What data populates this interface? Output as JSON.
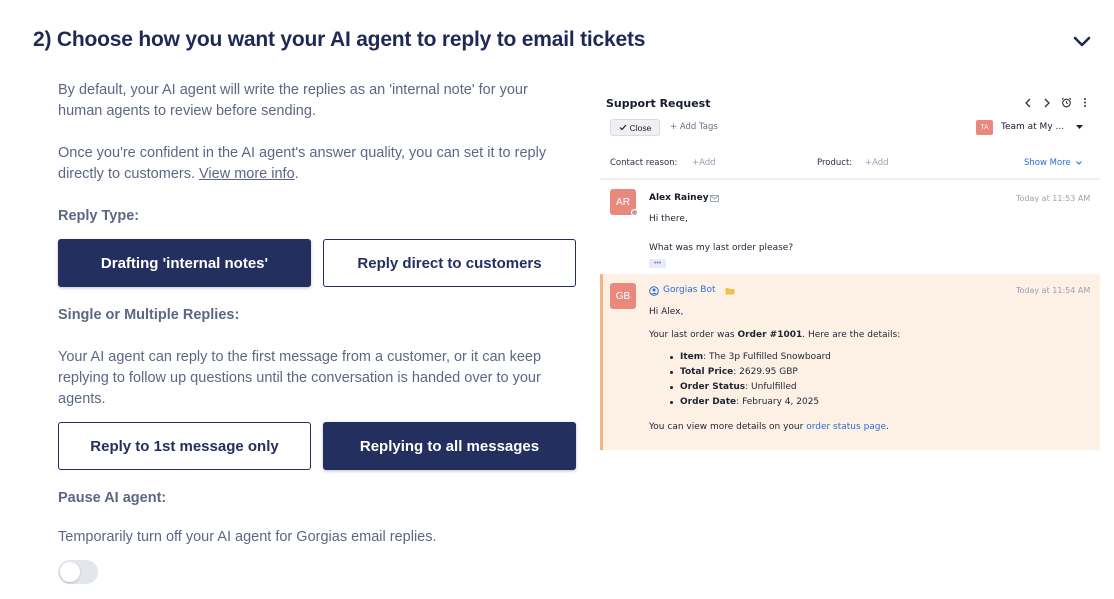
{
  "section": {
    "title": "2) Choose how you want your AI agent to reply to email tickets",
    "collapse_icon": "chevron-down-icon"
  },
  "intro": {
    "p1": "By default, your AI agent will write the replies as an 'internal note' for your human agents to review before sending.",
    "p2_prefix": "Once you're confident in the AI agent's answer quality, you can set it to reply directly to customers. ",
    "p2_link": "View more info",
    "p2_suffix": "."
  },
  "reply_type": {
    "label": "Reply Type:",
    "options": [
      {
        "label": "Drafting 'internal notes'",
        "selected": true
      },
      {
        "label": "Reply direct to customers",
        "selected": false
      }
    ]
  },
  "replies": {
    "label": "Single or Multiple Replies:",
    "description": "Your AI agent can reply to the first message from a customer, or it can keep replying to follow up questions until the conversation is handed over to your agents.",
    "options": [
      {
        "label": "Reply to 1st message only",
        "selected": false
      },
      {
        "label": "Replying to all messages",
        "selected": true
      }
    ]
  },
  "pause": {
    "label": "Pause AI agent:",
    "description": "Temporarily turn off your AI agent for Gorgias email replies.",
    "enabled": false
  },
  "preview": {
    "title": "Support Request",
    "close_label": "Close",
    "add_tags_label": "+ Add Tags",
    "team_initials": "TA",
    "team_label": "Team at My ...",
    "contact_reason_label": "Contact reason:",
    "contact_reason_add": "+Add",
    "product_label": "Product:",
    "product_add": "+Add",
    "show_more_label": "Show More",
    "colors": {
      "accent": "#232f5f",
      "link": "#2a6dd8",
      "bot_bg": "#fdf1e6",
      "avatar": "#e9897d"
    },
    "messages": [
      {
        "initials": "AR",
        "name": "Alex Rainey",
        "time": "Today at 11:53 AM",
        "greeting": "Hi there,",
        "body": "What was my last order please?",
        "ellipsis": "•••"
      },
      {
        "initials": "GB",
        "name": "Gorgias Bot",
        "time": "Today at 11:54 AM",
        "greeting": "Hi Alex,",
        "intro_prefix": "Your last order was ",
        "intro_bold": "Order #1001",
        "intro_suffix": ". Here are the details:",
        "details": [
          {
            "key": "Item",
            "value": ": The 3p Fulfilled Snowboard"
          },
          {
            "key": "Total Price",
            "value": ": 2629.95 GBP"
          },
          {
            "key": "Order Status",
            "value": ": Unfulfilled"
          },
          {
            "key": "Order Date",
            "value": ": February 4, 2025"
          }
        ],
        "outro_prefix": "You can view more details on your ",
        "outro_link": "order status page",
        "outro_suffix": "."
      }
    ]
  }
}
